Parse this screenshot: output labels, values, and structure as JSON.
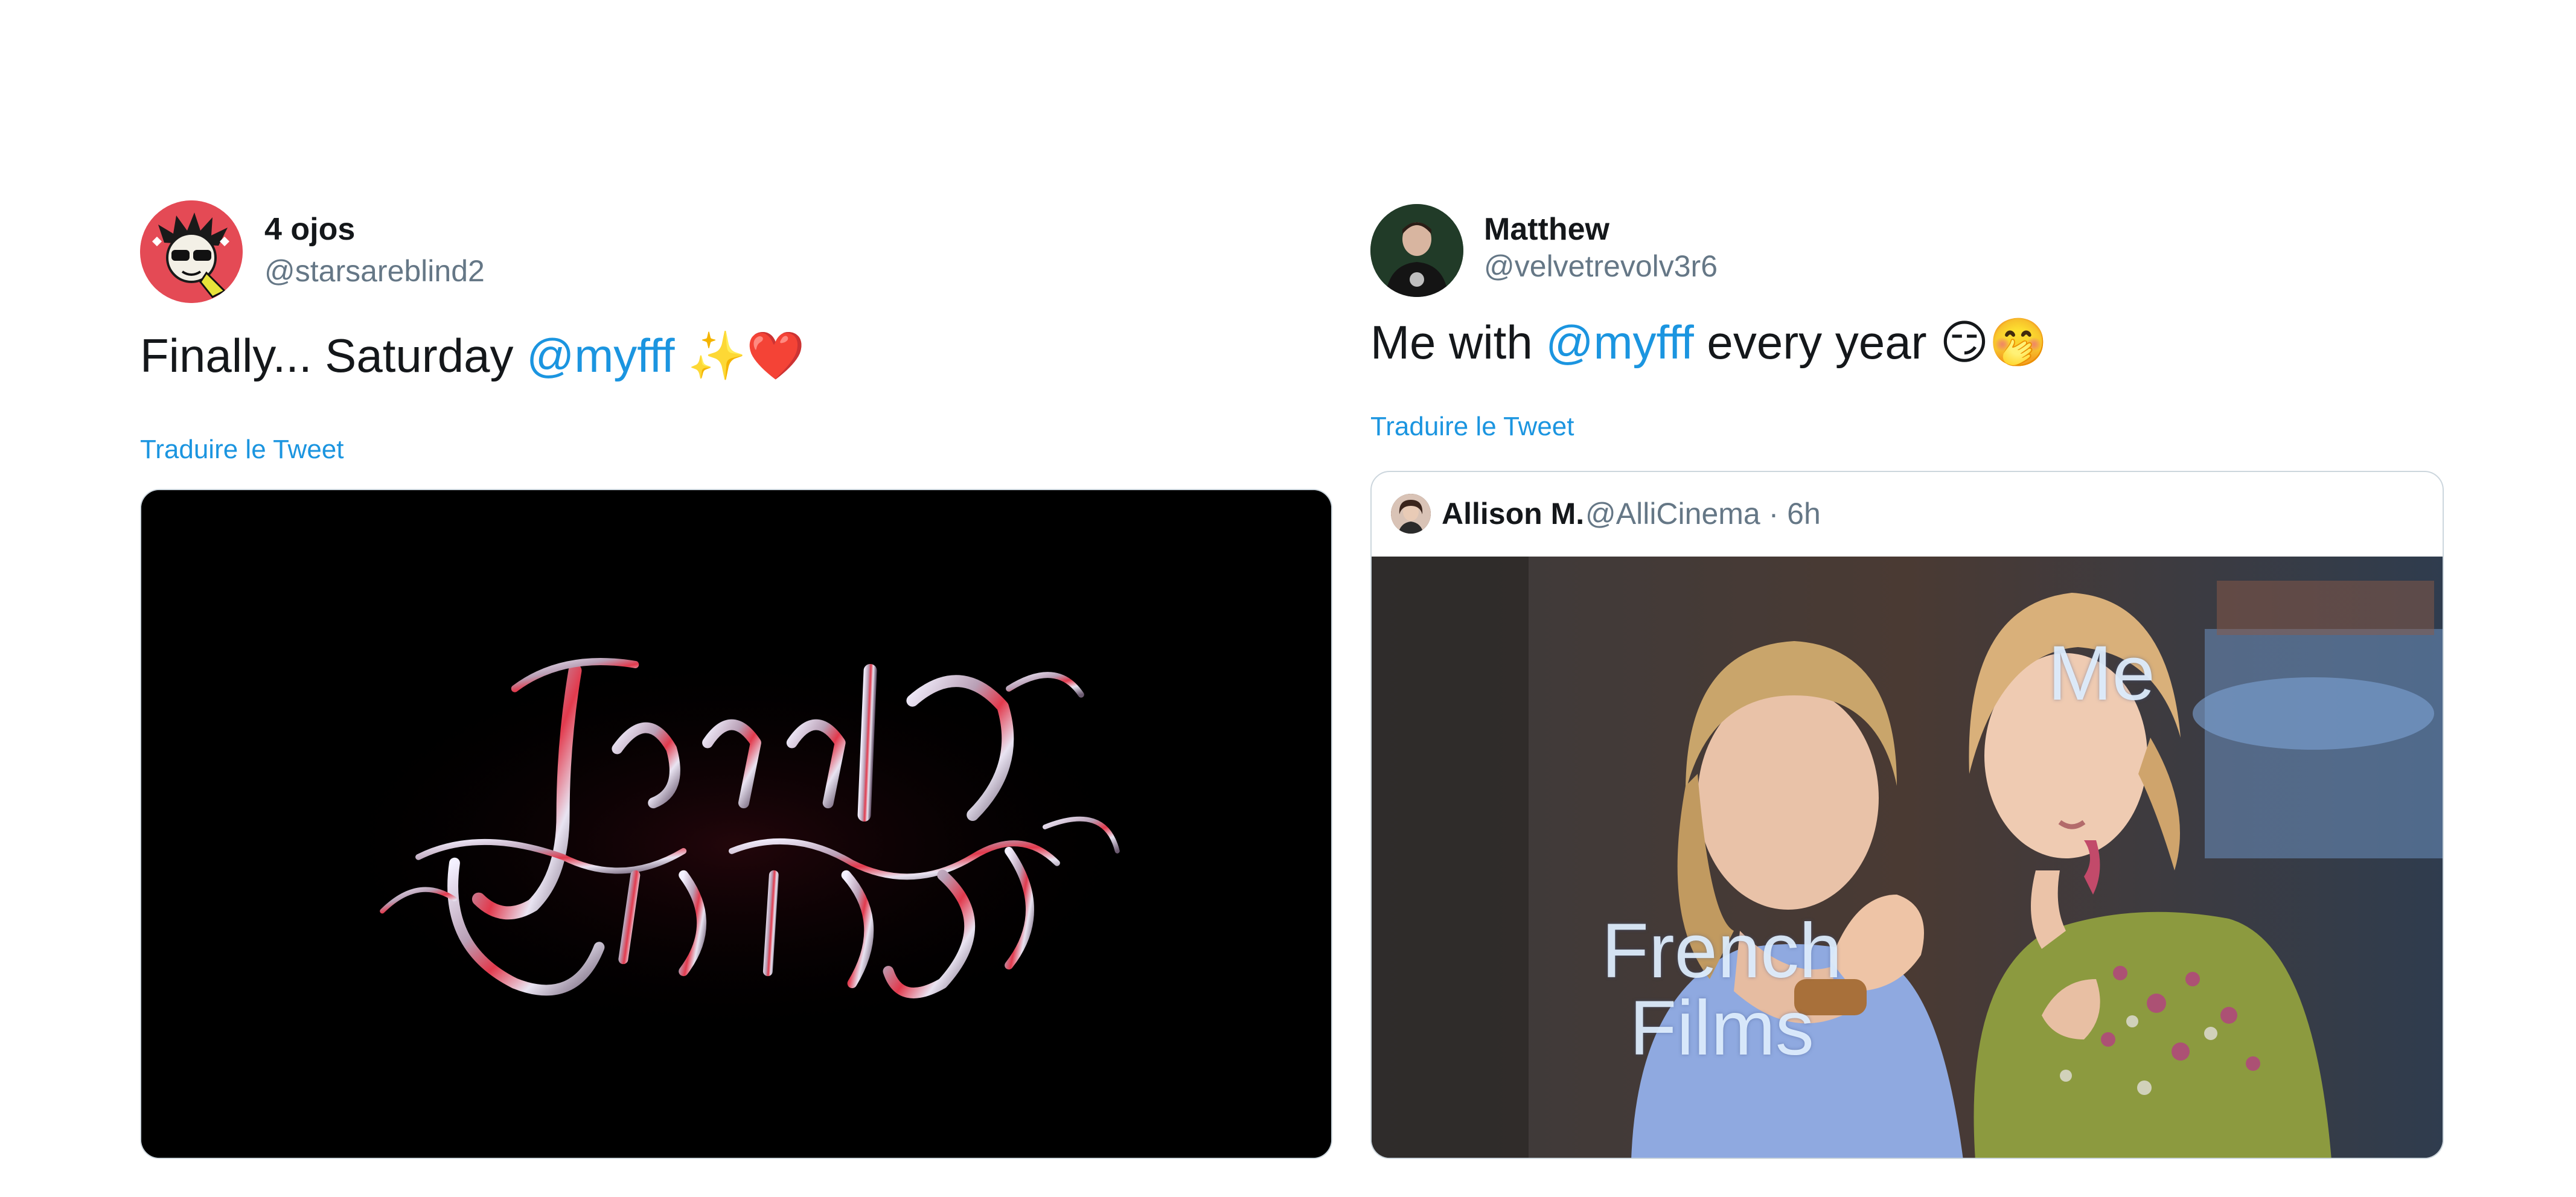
{
  "tweets": [
    {
      "author_name": "4 ojos",
      "author_handle": "@starsareblind2",
      "text_before": "Finally... Saturday ",
      "mention": "@myfff",
      "emojis": "✨❤️",
      "translate_label": "Traduire le Tweet",
      "media": {
        "kind": "image",
        "art_text": "Jessica Forever",
        "background": "#000000"
      }
    },
    {
      "author_name": "Matthew",
      "author_handle": "@velvetrevolv3r6",
      "text_before": "Me with ",
      "mention": "@myfff",
      "text_after": " every year ",
      "emojis": "😏🤭",
      "translate_label": "Traduire le Tweet",
      "quoted_tweet": {
        "author_name": "Allison M.",
        "author_handle": "@AlliCinema",
        "time": "6h",
        "meme_labels": {
          "right": "Me",
          "left": "French Films"
        }
      }
    }
  ],
  "colors": {
    "link": "#1b95e0",
    "text": "#14171a",
    "secondary": "#657786",
    "border": "#ccd6dd"
  }
}
